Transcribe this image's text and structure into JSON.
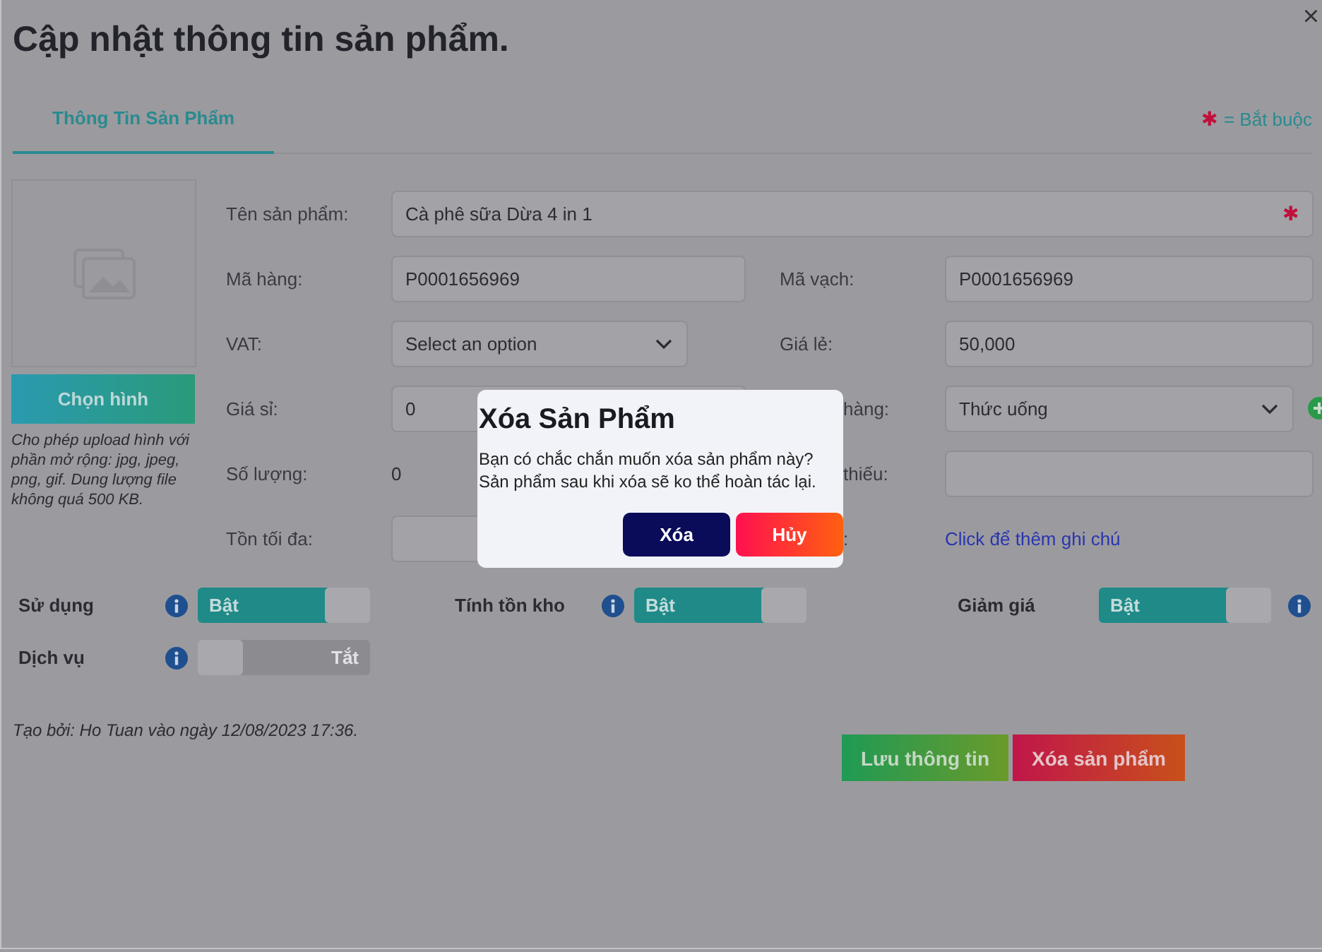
{
  "window": {
    "title": "Cập nhật thông tin sản phẩm.",
    "close": "×"
  },
  "tabs": [
    {
      "label": "Thông Tin Sản Phẩm",
      "selected": true
    }
  ],
  "required_note": {
    "mark": "✱",
    "text": "= Bắt buộc"
  },
  "image_panel": {
    "button": "Chọn hình",
    "hint": "Cho phép upload hình với phần mở rộng: jpg, jpeg, png, gif. Dung lượng file không quá 500 KB."
  },
  "form_rows": [
    {
      "cells": [
        {
          "label": "Tên sản phẩm:",
          "kind": "wide_input",
          "value": "Cà phê sữa Dừa 4 in 1",
          "required": true
        }
      ]
    },
    {
      "cells": [
        {
          "label": "Mã hàng:",
          "kind": "input",
          "value": "P0001656969"
        },
        {
          "label": "Mã vạch:",
          "kind": "input",
          "value": "P0001656969"
        }
      ]
    },
    {
      "cells": [
        {
          "label": "VAT:",
          "kind": "select",
          "placeholder": "Select an option"
        },
        {
          "label": "Giá lẻ:",
          "kind": "input",
          "value": "50,000"
        }
      ]
    },
    {
      "cells": [
        {
          "label": "Giá sỉ:",
          "kind": "input",
          "value": "0"
        },
        {
          "label": "hàng:",
          "clipped": true,
          "kind": "select_add",
          "value": "Thức uống"
        }
      ]
    },
    {
      "cells": [
        {
          "label": "Số lượng:",
          "kind": "text",
          "value": "0"
        },
        {
          "label": "thiếu:",
          "clipped": true,
          "kind": "input"
        }
      ]
    },
    {
      "cells": [
        {
          "label": "Tồn tối đa:",
          "kind": "input"
        },
        {
          "label": ":",
          "clipped": true,
          "kind": "link",
          "value": "Click để thêm ghi chú"
        }
      ]
    }
  ],
  "switch_rows": [
    [
      {
        "label": "Sử dụng",
        "on": true,
        "text": "Bật",
        "kind": "info_before"
      },
      {
        "label": "Tính tồn kho",
        "on": true,
        "text": "Bật",
        "kind": "info_before"
      },
      {
        "label": "Giảm giá",
        "on": true,
        "text": "Bật",
        "kind": "info_after"
      }
    ],
    [
      {
        "label": "Dịch vụ",
        "on": false,
        "text": "Tắt",
        "kind": "info_before"
      }
    ]
  ],
  "created_note": "Tạo bởi: Ho Tuan vào ngày 12/08/2023 17:36.",
  "actions": [
    {
      "label": "Lưu thông tin",
      "kind": "save"
    },
    {
      "label": "Xóa sản phẩm",
      "kind": "delete"
    }
  ],
  "dialog": {
    "title": "Xóa Sản Phẩm",
    "message": "Bạn có chắc chắn muốn xóa sản phẩm này? Sản phẩm sau khi xóa sẽ ko thể hoàn tác lại.",
    "buttons": [
      {
        "label": "Xóa",
        "kind": "confirm"
      },
      {
        "label": "Hủy",
        "kind": "cancel"
      }
    ]
  }
}
